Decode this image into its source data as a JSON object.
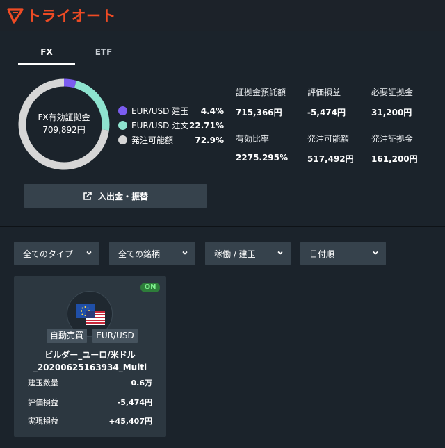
{
  "app": {
    "logo_text": "トライオート",
    "brand_color": "#ef4b24"
  },
  "tabs": [
    {
      "label": "FX",
      "active": true
    },
    {
      "label": "ETF",
      "active": false
    }
  ],
  "margin_chart": {
    "center_label": "FX有効証拠金",
    "center_value": "709,892円",
    "segments": [
      {
        "label": "EUR/USD 建玉",
        "percent_text": "4.4%",
        "percent": 4.4,
        "color": "#7b5cf0"
      },
      {
        "label": "EUR/USD 注文",
        "percent_text": "22.71%",
        "percent": 22.71,
        "color": "#8ee3cf"
      },
      {
        "label": "発注可能額",
        "percent_text": "72.9%",
        "percent": 72.9,
        "color": "#d6d6d6"
      }
    ]
  },
  "stats": [
    {
      "label": "証拠金預託額",
      "value": "715,366円"
    },
    {
      "label": "評価損益",
      "value": "-5,474円"
    },
    {
      "label": "必要証拠金",
      "value": "31,200円"
    },
    {
      "label": "有効比率",
      "value": "2275.295%"
    },
    {
      "label": "発注可能額",
      "value": "517,492円"
    },
    {
      "label": "発注証拠金",
      "value": "161,200円"
    }
  ],
  "deposit_button": {
    "label": "入出金・振替",
    "icon": "external-link-icon"
  },
  "filters": [
    {
      "value": "全てのタイプ"
    },
    {
      "value": "全ての銘柄"
    },
    {
      "value": "稼働 / 建玉"
    },
    {
      "value": "日付順"
    }
  ],
  "strategy_card": {
    "status": "ON",
    "icons": [
      "eu-flag-icon",
      "us-flag-icon"
    ],
    "tags": [
      "自動売買",
      "EUR/USD"
    ],
    "title_line1": "ビルダー_ユーロ/米ドル",
    "title_line2": "_20200625163934_Multi",
    "rows": [
      {
        "label": "建玉数量",
        "value": "0.6万"
      },
      {
        "label": "評価損益",
        "value": "-5,474円"
      },
      {
        "label": "実現損益",
        "value": "+45,407円"
      }
    ]
  }
}
